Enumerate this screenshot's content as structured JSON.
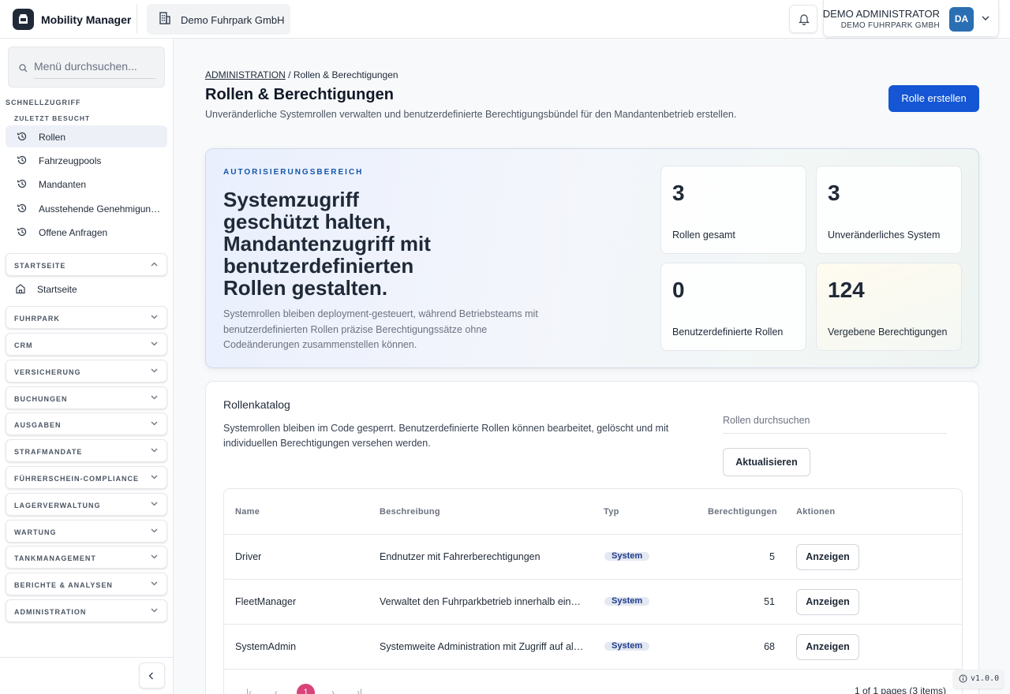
{
  "header": {
    "app_name": "Mobility Manager",
    "tenant": "Demo Fuhrpark GmbH",
    "user_name": "DEMO ADMINISTRATOR",
    "user_org": "DEMO FUHRPARK GMBH",
    "avatar_initials": "DA"
  },
  "sidebar": {
    "search_placeholder": "Menü durchsuchen...",
    "quick_access": "SCHNELLZUGRIFF",
    "recent_label": "ZULETZT BESUCHT",
    "recent": [
      "Rollen",
      "Fahrzeugpools",
      "Mandanten",
      "Ausstehende Genehmigungen",
      "Offene Anfragen"
    ],
    "home_group": "STARTSEITE",
    "home_item": "Startseite",
    "groups": [
      "FUHRPARK",
      "CRM",
      "VERSICHERUNG",
      "BUCHUNGEN",
      "AUSGABEN",
      "STRAFMANDATE",
      "FÜHRERSCHEIN-COMPLIANCE",
      "LAGERVERWALTUNG",
      "WARTUNG",
      "TANKMANAGEMENT",
      "BERICHTE & ANALYSEN",
      "ADMINISTRATION"
    ]
  },
  "page": {
    "breadcrumb_root": "ADMINISTRATION",
    "breadcrumb_sep": "/",
    "breadcrumb_current": "Rollen & Berechtigungen",
    "title": "Rollen & Berechtigungen",
    "subtitle": "Unveränderliche Systemrollen verwalten und benutzerdefinierte Berechtigungsbündel für den Mandantenbetrieb erstellen.",
    "create_button": "Rolle erstellen"
  },
  "hero": {
    "kicker": "AUTORISIERUNGSBEREICH",
    "title": "Systemzugriff geschützt halten, Mandantenzugriff mit benutzerdefinierten Rollen gestalten.",
    "description": "Systemrollen bleiben deployment-gesteuert, während Betriebsteams mit benutzerdefinierten Rollen präzise Berechtigungssätze ohne Codeänderungen zusammenstellen können.",
    "stats": [
      {
        "value": "3",
        "label": "Rollen gesamt"
      },
      {
        "value": "3",
        "label": "Unveränderliches System"
      },
      {
        "value": "0",
        "label": "Benutzerdefinierte Rollen"
      },
      {
        "value": "124",
        "label": "Vergebene Berechtigungen"
      }
    ]
  },
  "catalog": {
    "title": "Rollenkatalog",
    "description": "Systemrollen bleiben im Code gesperrt. Benutzerdefinierte Rollen können bearbeitet, gelöscht und mit individuellen Berechtigungen versehen werden.",
    "search_placeholder": "Rollen durchsuchen",
    "refresh_button": "Aktualisieren",
    "columns": [
      "Name",
      "Beschreibung",
      "Typ",
      "Berechtigungen",
      "Aktionen"
    ],
    "rows": [
      {
        "name": "Driver",
        "description": "Endnutzer mit Fahrerberechtigungen",
        "type": "System",
        "permissions": "5",
        "action": "Anzeigen"
      },
      {
        "name": "FleetManager",
        "description": "Verwaltet den Fuhrparkbetrieb innerhalb eines Mandanten",
        "type": "System",
        "permissions": "51",
        "action": "Anzeigen"
      },
      {
        "name": "SystemAdmin",
        "description": "Systemweite Administration mit Zugriff auf alle Mandanten",
        "type": "System",
        "permissions": "68",
        "action": "Anzeigen"
      }
    ],
    "pager": {
      "current_page": "1",
      "info": "1 of 1 pages (3 items)"
    }
  },
  "footer": {
    "version": "v1.0.0"
  },
  "colors": {
    "primary": "#1456d4",
    "active_page": "#d9437a",
    "avatar": "#2a6fb3"
  }
}
